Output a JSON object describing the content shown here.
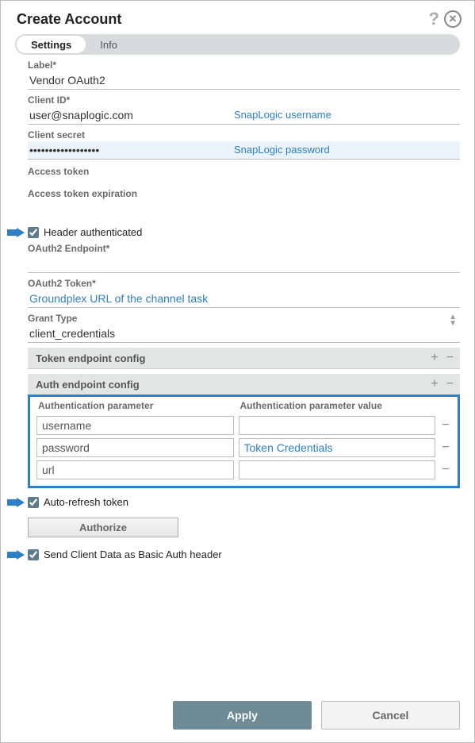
{
  "dialog": {
    "title": "Create Account"
  },
  "tabs": {
    "settings": "Settings",
    "info": "Info"
  },
  "fields": {
    "label": {
      "label": "Label*",
      "value": "Vendor OAuth2"
    },
    "clientId": {
      "label": "Client ID*",
      "value": "user@snaplogic.com",
      "hint": "SnapLogic username"
    },
    "clientSecret": {
      "label": "Client secret",
      "value": "••••••••••••••••••",
      "hint": "SnapLogic password"
    },
    "accessToken": {
      "label": "Access token"
    },
    "accessTokenExp": {
      "label": "Access token expiration"
    },
    "headerAuth": {
      "label": "Header authenticated"
    },
    "oauthEndpoint": {
      "label": "OAuth2 Endpoint*",
      "value": ""
    },
    "oauthToken": {
      "label": "OAuth2 Token*",
      "value": "Groundplex URL of the channel task"
    },
    "grantType": {
      "label": "Grant Type",
      "value": "client_credentials"
    },
    "tokenEndpointConfig": {
      "title": "Token endpoint config"
    },
    "authEndpointConfig": {
      "title": "Auth endpoint config",
      "col1": "Authentication parameter",
      "col2": "Authentication parameter value",
      "rows": [
        {
          "param": "username",
          "value": ""
        },
        {
          "param": "password",
          "value": "Token Credentials"
        },
        {
          "param": "url",
          "value": ""
        }
      ]
    },
    "autoRefresh": {
      "label": "Auto-refresh token"
    },
    "authorize": {
      "label": "Authorize"
    },
    "sendBasic": {
      "label": "Send Client Data as Basic Auth header"
    }
  },
  "footer": {
    "apply": "Apply",
    "cancel": "Cancel"
  }
}
